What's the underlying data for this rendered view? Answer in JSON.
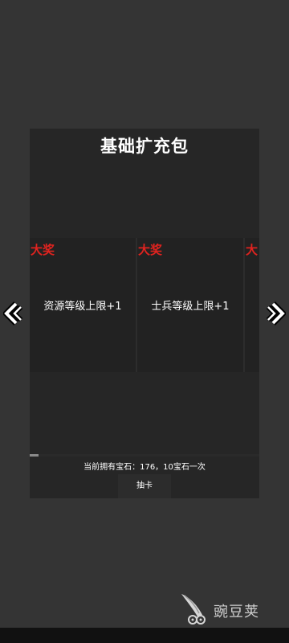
{
  "pack": {
    "title": "基础扩充包"
  },
  "cards": [
    {
      "badge": "大奖",
      "label": "资源等级上限+1"
    },
    {
      "badge": "大奖",
      "label": "士兵等级上限+1"
    },
    {
      "badge": "大",
      "label": ""
    }
  ],
  "gems": {
    "info_text": "当前拥有宝石：176，10宝石一次"
  },
  "draw_button": {
    "label": "抽卡"
  },
  "scroll": {
    "progress_percent": 4
  },
  "watermark": {
    "text": "豌豆荚"
  },
  "colors": {
    "background": "#343434",
    "panel": "#262626",
    "card": "#222222",
    "badge": "#e0231f",
    "text": "#ffffff"
  },
  "icons": {
    "left_arrow": "chevron-left-icon",
    "right_arrow": "chevron-right-icon",
    "watermark_logo": "wandoujia-logo-icon"
  }
}
